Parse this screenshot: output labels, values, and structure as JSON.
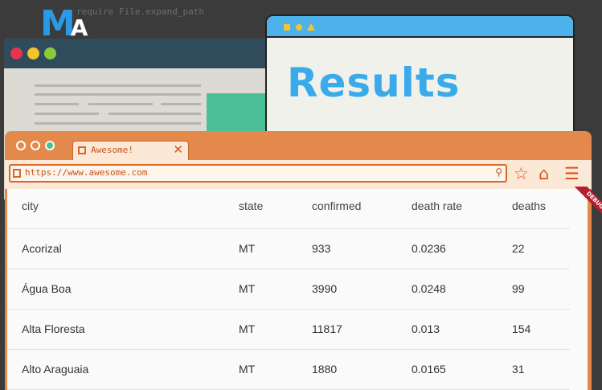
{
  "background": {
    "code_text": "require File.expand_path",
    "logo_letter": "M",
    "logo_sub": "A"
  },
  "results_window": {
    "title": "Results"
  },
  "browser": {
    "tab_label": "Awesome!",
    "tab_close": "✕",
    "url": "https://www.awesome.com",
    "icons": [
      "search-icon",
      "star-icon",
      "home-icon",
      "menu-icon"
    ]
  },
  "table": {
    "columns": [
      "city",
      "state",
      "confirmed",
      "death rate",
      "deaths"
    ],
    "rows": [
      [
        "Acorizal",
        "MT",
        "933",
        "0.0236",
        "22"
      ],
      [
        "Água Boa",
        "MT",
        "3990",
        "0.0248",
        "99"
      ],
      [
        "Alta Floresta",
        "MT",
        "11817",
        "0.013",
        "154"
      ],
      [
        "Alto Araguaia",
        "MT",
        "1880",
        "0.0165",
        "31"
      ]
    ]
  },
  "debug_banner": "DEBUG",
  "colors": {
    "accent_orange": "#e2894b",
    "results_blue": "#3aaaea",
    "logo_blue": "#2b9ae6",
    "debug_red": "#b31f2d"
  }
}
